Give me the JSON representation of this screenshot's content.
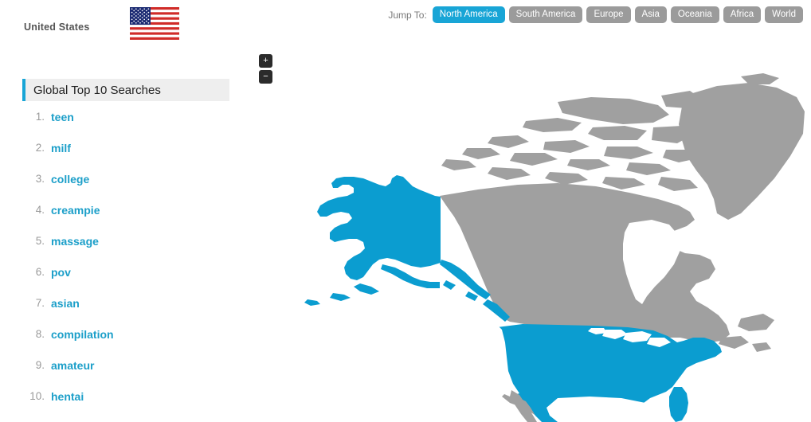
{
  "sidebar": {
    "country_name": "United States",
    "flag": {
      "icon": "us-flag-icon",
      "alt": "United States flag"
    },
    "panel": {
      "title": "Global Top 10 Searches",
      "accent_color": "#18a5d6",
      "items": [
        {
          "rank": "1.",
          "term": "teen"
        },
        {
          "rank": "2.",
          "term": "milf"
        },
        {
          "rank": "3.",
          "term": "college"
        },
        {
          "rank": "4.",
          "term": "creampie"
        },
        {
          "rank": "5.",
          "term": "massage"
        },
        {
          "rank": "6.",
          "term": "pov"
        },
        {
          "rank": "7.",
          "term": "asian"
        },
        {
          "rank": "8.",
          "term": "compilation"
        },
        {
          "rank": "9.",
          "term": "amateur"
        },
        {
          "rank": "10.",
          "term": "hentai"
        }
      ]
    }
  },
  "jump_nav": {
    "label": "Jump To:",
    "active": "North America",
    "buttons": [
      {
        "label": "North America",
        "active": true
      },
      {
        "label": "South America",
        "active": false
      },
      {
        "label": "Europe",
        "active": false
      },
      {
        "label": "Asia",
        "active": false
      },
      {
        "label": "Oceania",
        "active": false
      },
      {
        "label": "Africa",
        "active": false
      },
      {
        "label": "World",
        "active": false
      }
    ]
  },
  "map": {
    "zoom_in_label": "+",
    "zoom_out_label": "−",
    "region": "North America",
    "highlight_color": "#0b9dd0",
    "land_color": "#a0a0a0",
    "ocean_color": "#ffffff",
    "highlighted_countries": [
      "United States"
    ]
  }
}
